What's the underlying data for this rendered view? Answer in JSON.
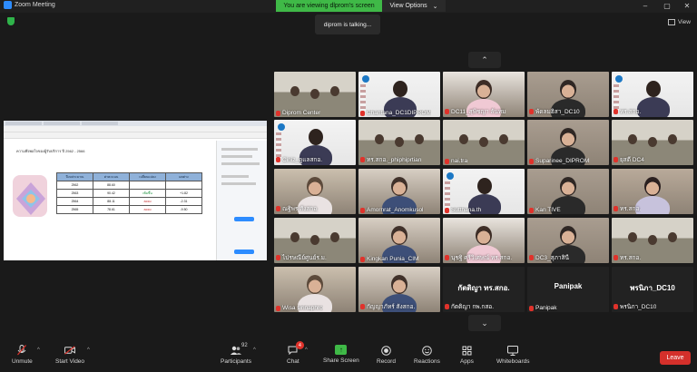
{
  "window": {
    "app_title": "Zoom Meeting",
    "viewing_badge": "You are viewing dlprom's screen",
    "view_options_label": "View Options",
    "view_button_label": "View"
  },
  "talking_toast": "diprom is talking...",
  "shared_screen": {
    "doc_title": "ความพึงพอใจของผู้รับบริการ ปี 2562 - 2566",
    "table": {
      "headers": [
        "ปีงบประมาณ",
        "ค่าคะแนน",
        "เปลี่ยนแปลง",
        "ผลต่าง"
      ],
      "rows": [
        [
          "2562",
          "88.60",
          "",
          ""
        ],
        [
          "2563",
          "90.42",
          "เพิ่มขึ้น",
          "+1.82"
        ],
        [
          "2564",
          "88.11",
          "ลดลง",
          "-2.31"
        ],
        [
          "2565",
          "78.61",
          "ลดลง",
          "-9.50"
        ]
      ]
    }
  },
  "gallery": [
    {
      "name": "Diprom Center",
      "type": "room"
    },
    {
      "name": "Chantana_DC1DIPROM",
      "type": "wall"
    },
    {
      "name": "DC11_สุพิชญา ลั่นทม",
      "type": "face"
    },
    {
      "name": "พัดลมฮิสา_DC10",
      "type": "face"
    },
    {
      "name": "ทร.สกอ.",
      "type": "wall"
    },
    {
      "name": "Ciniz_ดูแลสกอ.",
      "type": "wall"
    },
    {
      "name": "ทร.สกอ._phiphiprtian",
      "type": "room"
    },
    {
      "name": "nai.tra",
      "type": "room"
    },
    {
      "name": "Suparinee_DIPROM",
      "type": "face"
    },
    {
      "name": "ยุสตี DC4",
      "type": "room"
    },
    {
      "name": "ณฐิพร สังสกอ.",
      "type": "face"
    },
    {
      "name": "Amornrat_Anomkusol",
      "type": "face"
    },
    {
      "name": "Sutthana.th",
      "type": "wall"
    },
    {
      "name": "Kan TIVE",
      "type": "face"
    },
    {
      "name": "ทร.สกอ.",
      "type": "face"
    },
    {
      "name": "ไปรษณีย์ศูนย์ร.ม.",
      "type": "room"
    },
    {
      "name": "Kingkan Punia_CIM",
      "type": "face"
    },
    {
      "name": "นุชฐิ ศรีวิเศษณ์ ทร.สกอ.",
      "type": "face"
    },
    {
      "name": "DC3_สุภาสินี",
      "type": "face"
    },
    {
      "name": "ทร.สกอ.",
      "type": "room"
    },
    {
      "name": "Wisa sirinaphro",
      "type": "face"
    },
    {
      "name": "กัญญาภัทร์ สังสกอ.",
      "type": "face"
    },
    {
      "name": "กัตติญา กพ.กสอ.",
      "type": "name",
      "label": "กัตติญา ทร.สกอ."
    },
    {
      "name": "Panipak",
      "type": "name",
      "label": "Panipak"
    },
    {
      "name": "พรนิภา_DC10",
      "type": "name",
      "label": "พรนิภา_DC10"
    }
  ],
  "toolbar": {
    "unmute": "Unmute",
    "start_video": "Start Video",
    "participants": "Participants",
    "participants_count": "92",
    "chat": "Chat",
    "chat_badge": "4",
    "share_screen": "Share Screen",
    "record": "Record",
    "reactions": "Reactions",
    "apps": "Apps",
    "whiteboards": "Whiteboards",
    "leave": "Leave"
  },
  "colors": {
    "accent_green": "#3fb947",
    "leave_red": "#d4302b",
    "muted_red": "#e0322b"
  }
}
